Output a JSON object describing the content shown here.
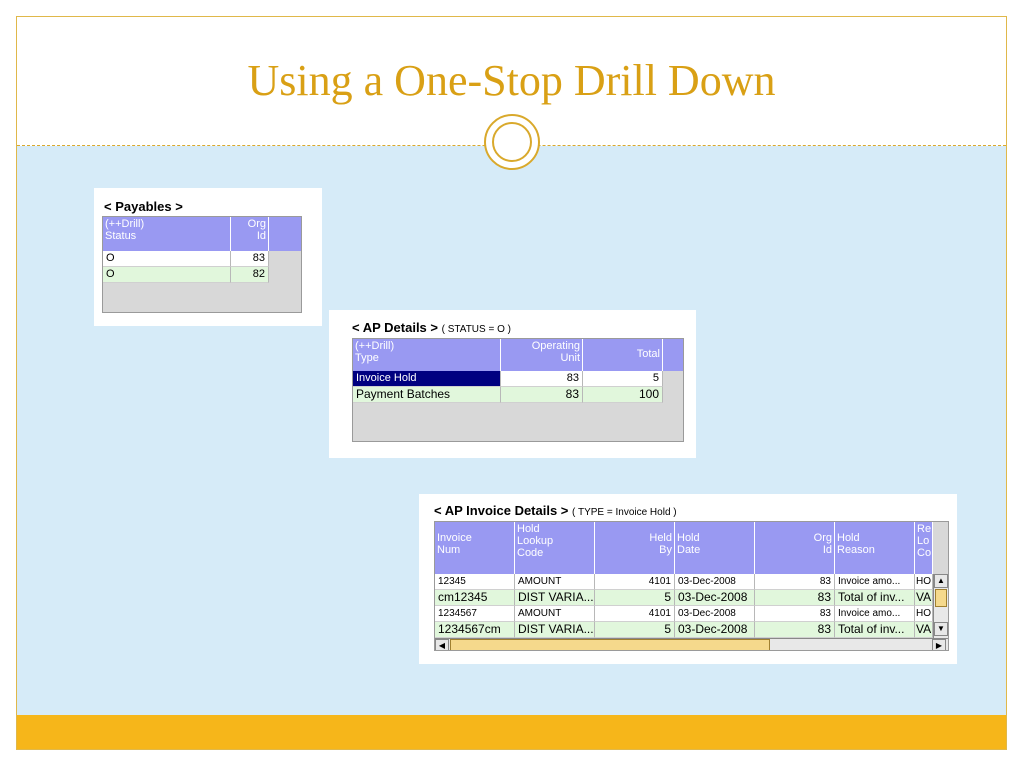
{
  "slide": {
    "title": "Using a One-Stop Drill Down"
  },
  "payables": {
    "title": "< Payables >",
    "headers": {
      "status": "(++Drill)\nStatus",
      "org_id": "Org\nId"
    },
    "rows": [
      {
        "status": "O",
        "org_id": "83"
      },
      {
        "status": "O",
        "org_id": "82"
      }
    ]
  },
  "ap_details": {
    "title": "< AP Details >",
    "condition": "( STATUS = O )",
    "headers": {
      "type": "(++Drill)\nType",
      "operating_unit": "Operating\nUnit",
      "total": "Total"
    },
    "rows": [
      {
        "type": "Invoice Hold",
        "operating_unit": "83",
        "total": "5"
      },
      {
        "type": "Payment Batches",
        "operating_unit": "83",
        "total": "100"
      }
    ]
  },
  "ap_invoice_details": {
    "title": "< AP Invoice Details >",
    "condition": "( TYPE = Invoice Hold )",
    "headers": {
      "invoice_num": "Invoice\nNum",
      "hold_lookup_code": "Hold\nLookup\nCode",
      "held_by": "Held\nBy",
      "hold_date": "Hold\nDate",
      "org_id": "Org\nId",
      "hold_reason": "Hold\nReason",
      "release_lookup_code": "Re\nLo\nCo"
    },
    "rows": [
      {
        "invoice_num": "12345",
        "hold_lookup_code": "AMOUNT",
        "held_by": "4101",
        "hold_date": "03-Dec-2008",
        "org_id": "83",
        "hold_reason": "Invoice amo...",
        "release": "HO"
      },
      {
        "invoice_num": "cm12345",
        "hold_lookup_code": "DIST VARIA...",
        "held_by": "5",
        "hold_date": "03-Dec-2008",
        "org_id": "83",
        "hold_reason": "Total of inv...",
        "release": "VA"
      },
      {
        "invoice_num": "1234567",
        "hold_lookup_code": "AMOUNT",
        "held_by": "4101",
        "hold_date": "03-Dec-2008",
        "org_id": "83",
        "hold_reason": "Invoice amo...",
        "release": "HO"
      },
      {
        "invoice_num": "1234567cm",
        "hold_lookup_code": "DIST VARIA...",
        "held_by": "5",
        "hold_date": "03-Dec-2008",
        "org_id": "83",
        "hold_reason": "Total of inv...",
        "release": "VA"
      }
    ],
    "scroll_icons": {
      "up": "arrow-up-icon",
      "down": "arrow-down-icon",
      "left": "arrow-left-icon",
      "right": "arrow-right-icon"
    }
  },
  "colors": {
    "title": "#d9a015",
    "header_bg": "#9999f2",
    "row_alt": "#e1f7dc",
    "selected": "#000080",
    "slide_bg": "#d6ebf8",
    "footer": "#f6b61a"
  }
}
